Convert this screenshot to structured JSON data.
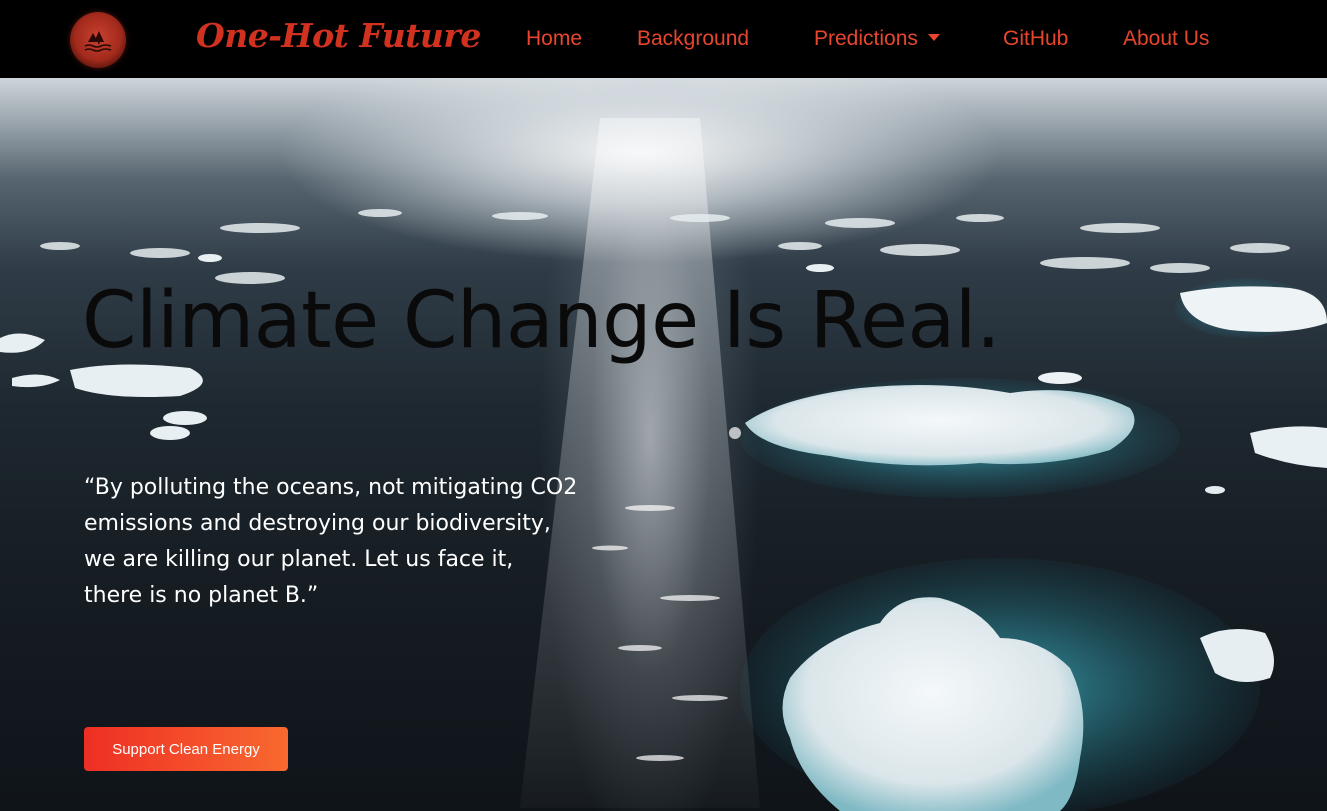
{
  "brand": {
    "name": "One-Hot Future",
    "logo_icon": "logo-icon"
  },
  "nav": {
    "items": [
      {
        "label": "Home"
      },
      {
        "label": "Background"
      },
      {
        "label": "Predictions",
        "dropdown": true
      },
      {
        "label": "GitHub"
      },
      {
        "label": "About Us"
      }
    ]
  },
  "hero": {
    "headline": "Climate Change Is Real.",
    "quote": "“By polluting the oceans, not mitigating CO2\nemissions and destroying our biodiversity,\nwe are killing our planet. Let us face it,\nthere is no planet B.”",
    "cta_label": "Support Clean Energy"
  },
  "colors": {
    "nav_background": "#000000",
    "accent_red": "#e8452d",
    "brand_red": "#d1311f",
    "cta_gradient_start": "#ee2f24",
    "cta_gradient_end": "#f8692f",
    "headline_text": "#0a0a0a",
    "quote_text": "#ffffff"
  }
}
